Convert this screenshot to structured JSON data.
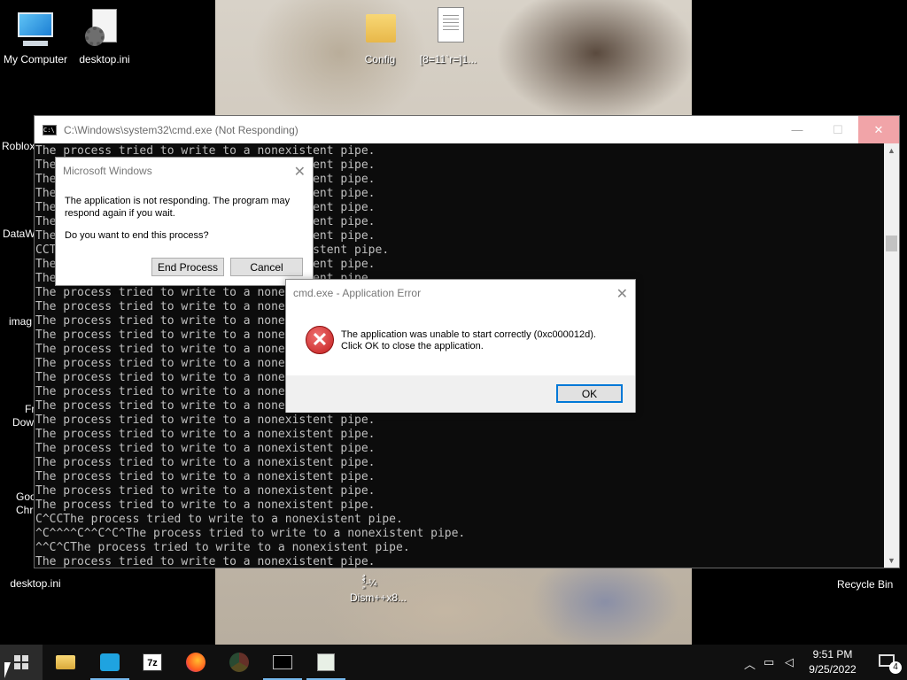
{
  "desktop": {
    "icons": {
      "my_computer": "My Computer",
      "desktop_ini_top": "desktop.ini",
      "config": "Config",
      "garbled_file": "[8=11`r=]1...",
      "roblox_partial": "Roblox",
      "dataw_partial": "DataW",
      "image_partial": "imag",
      "fr_partial": "Fr",
      "dow_partial": "Dow",
      "google_partial": "Goo",
      "chrome_partial": "Chr",
      "desktop_ini_bottom": "desktop.ini",
      "dism": "Dism++x8...",
      "dism_top": "ٌٍ³ٌ-¼",
      "recycle_bin": "Recycle Bin"
    }
  },
  "cmd": {
    "title": "C:\\Windows\\system32\\cmd.exe (Not Responding)",
    "icon_text": "C:\\",
    "min_glyph": "—",
    "max_glyph": "☐",
    "close_glyph": "✕",
    "scroll_up": "▲",
    "scroll_down": "▼",
    "lines": [
      "The process tried to write to a nonexistent pipe.",
      "The process tried to write to a nonexistent pipe.",
      "The process tried to write to a nonexistent pipe.",
      "The process tried to write to a nonexistent pipe.",
      "The process tried to write to a nonexistent pipe.",
      "The process tried to write to a nonexistent pipe.",
      "The process tried to write to a nonexistent pipe.",
      "CCThe process tried to write to a nonexistent pipe.",
      "The process tried to write to a nonexistent pipe.",
      "The process tried to write to a nonexistent pipe.",
      "The process tried to write to a nonexistent pipe.",
      "The process tried to write to a nonexistent pipe.",
      "The process tried to write to a nonexistent pipe.",
      "The process tried to write to a nonexistent pipe.",
      "The process tried to write to a nonexistent pipe.",
      "The process tried to write to a nonexistent pipe.",
      "The process tried to write to a nonexistent pipe.",
      "The process tried to write to a nonexistent pipe.",
      "The process tried to write to a nonexistent pipe.",
      "The process tried to write to a nonexistent pipe.",
      "The process tried to write to a nonexistent pipe.",
      "The process tried to write to a nonexistent pipe.",
      "The process tried to write to a nonexistent pipe.",
      "The process tried to write to a nonexistent pipe.",
      "The process tried to write to a nonexistent pipe.",
      "The process tried to write to a nonexistent pipe.",
      "C^CCThe process tried to write to a nonexistent pipe.",
      "^C^^^^C^^C^C^The process tried to write to a nonexistent pipe.",
      "^^C^CThe process tried to write to a nonexistent pipe.",
      "The process tried to write to a nonexistent pipe."
    ]
  },
  "not_responding_dialog": {
    "title": "Microsoft Windows",
    "message": "The application is not responding. The program may respond again if you wait.",
    "question": "Do you want to end this process?",
    "end_button": "End Process",
    "cancel_button": "Cancel",
    "close_glyph": "✕"
  },
  "app_error_dialog": {
    "title": "cmd.exe - Application Error",
    "icon_glyph": "✕",
    "message": "The application was unable to start correctly (0xc000012d).\nClick OK to close the application.",
    "ok_button": "OK",
    "close_glyph": "✕"
  },
  "taskbar": {
    "clock_time": "9:51 PM",
    "clock_date": "9/25/2022",
    "notification_count": "4",
    "tray_chevron": "︿",
    "network_glyph": "▭",
    "volume_glyph": "◁"
  }
}
